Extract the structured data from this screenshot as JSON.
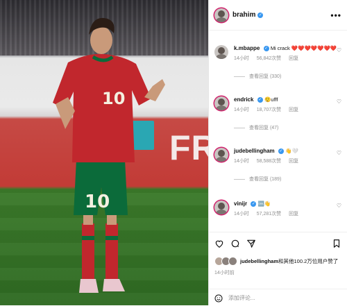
{
  "header": {
    "username": "brahim",
    "more_icon": "more-horizontal-icon"
  },
  "photo": {
    "banner_text": "FR",
    "jersey_number": "10",
    "shorts_number": "10"
  },
  "comments": [
    {
      "username": "k.mbappe",
      "verified": true,
      "text": "Mi crack ❤️❤️❤️❤️❤️❤️❤️",
      "time": "14小时",
      "likes": "56,842次赞",
      "reply": "回复",
      "view_replies": "查看回复 (330)"
    },
    {
      "username": "endrick",
      "verified": true,
      "text": "😮‍💨ufff",
      "time": "14小时",
      "likes": "18,707次赞",
      "reply": "回复",
      "view_replies": "查看回复 (47)"
    },
    {
      "username": "judebellingham",
      "verified": true,
      "text": "👋🤍",
      "time": "14小时",
      "likes": "58,588次赞",
      "reply": "回复",
      "view_replies": "查看回复 (189)"
    },
    {
      "username": "vinijr",
      "verified": true,
      "text": "🆒👋",
      "time": "14小时",
      "likes": "57,281次赞",
      "reply": "回复",
      "view_replies": ""
    }
  ],
  "likes_summary": {
    "bold": "judebellingham",
    "rest": "和其他100.2万位用户赞了"
  },
  "post_time": "14小时前",
  "add_comment": {
    "placeholder": "添加评论..."
  },
  "colors": {
    "verified": "#3897f0",
    "meta": "#8e8e8e",
    "ring": "#d0206b",
    "jersey_red": "#c1272d",
    "jersey_green": "#0b6b3a"
  }
}
